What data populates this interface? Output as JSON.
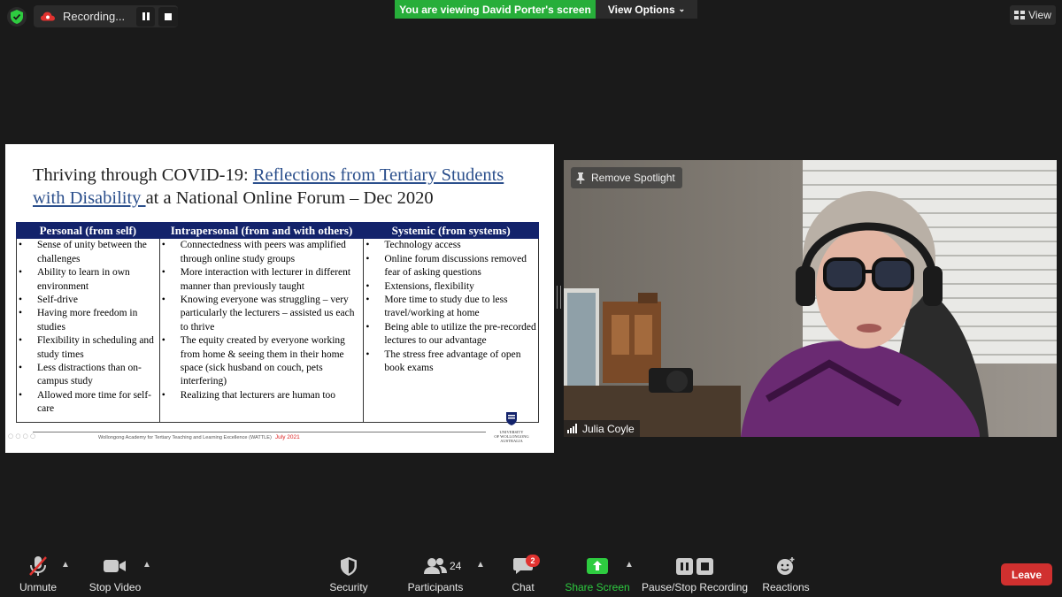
{
  "top_bar": {
    "recording_label": "Recording...",
    "viewing_banner": "You are viewing David Porter's screen",
    "view_options_label": "View Options",
    "view_label": "View"
  },
  "slide": {
    "title_plain": "Thriving through COVID-19: ",
    "title_link": "Reflections from Tertiary Students with Disability ",
    "title_rest": "at a National Online Forum – Dec 2020",
    "columns": [
      {
        "header": "Personal (from self)",
        "items": [
          "Sense of unity between the challenges",
          "Ability to learn in own environment",
          "Self-drive",
          "Having more freedom in studies",
          "Flexibility in scheduling and study times",
          "Less distractions than on-campus study",
          "Allowed more time for self-care"
        ]
      },
      {
        "header": "Intrapersonal (from and with others)",
        "items": [
          "Connectedness with peers was amplified through online study groups",
          "More interaction with lecturer in different manner than previously taught",
          "Knowing everyone was struggling – very particularly the lecturers – assisted us each to thrive",
          "The equity created by everyone working from home & seeing them in their home space (sick husband on couch, pets interfering)",
          "Realizing that lecturers are human too"
        ]
      },
      {
        "header": "Systemic (from systems)",
        "items": [
          "Technology access",
          "Online forum discussions removed fear of asking questions",
          "Extensions, flexibility",
          "More time to study due to less travel/working at home",
          "Being able to utilize the pre-recorded lectures to our advantage",
          "The stress free advantage of open book exams"
        ]
      }
    ],
    "footer_text": "Wollongong Academy for Tertiary Teaching and Learning Excellence (WATTLE)",
    "footer_date": "July 2021",
    "logo_text_1": "UNIVERSITY",
    "logo_text_2": "OF WOLLONGONG",
    "logo_text_3": "AUSTRALIA"
  },
  "video": {
    "spotlight_label": "Remove Spotlight",
    "participant_name": "Julia Coyle"
  },
  "toolbar": {
    "unmute": "Unmute",
    "stop_video": "Stop Video",
    "security": "Security",
    "participants": "Participants",
    "participants_count": "24",
    "chat": "Chat",
    "chat_badge": "2",
    "share_screen": "Share Screen",
    "pause_stop_recording": "Pause/Stop Recording",
    "reactions": "Reactions",
    "leave": "Leave"
  },
  "colors": {
    "banner_green": "#27ae3a",
    "table_header_navy": "#13236b",
    "leave_red": "#d0302f",
    "share_green": "#2ecc40",
    "link_blue": "#2b4f8c"
  }
}
